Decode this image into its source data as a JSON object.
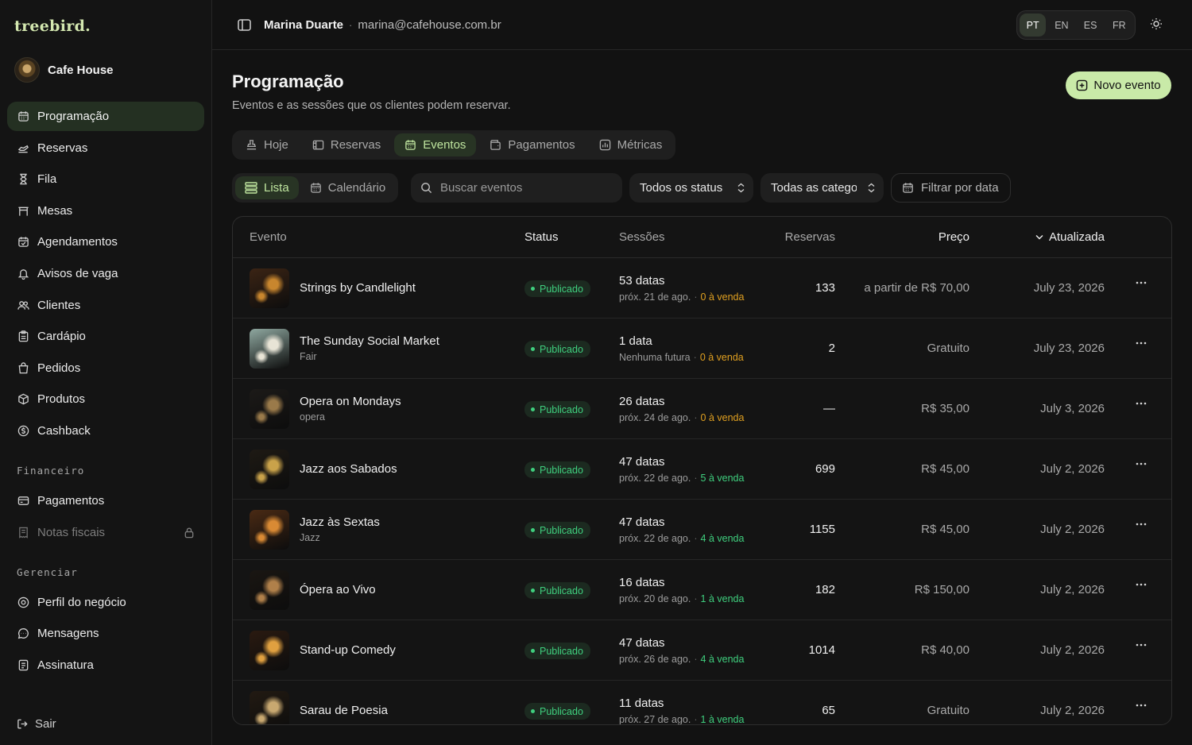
{
  "brand": {
    "logo": "treebird.",
    "business_name": "Cafe House"
  },
  "sidebar": {
    "items": [
      {
        "label": "Programação",
        "icon": "calendar-icon",
        "active": true
      },
      {
        "label": "Reservas",
        "icon": "hand-icon"
      },
      {
        "label": "Fila",
        "icon": "hourglass-icon"
      },
      {
        "label": "Mesas",
        "icon": "table-icon"
      },
      {
        "label": "Agendamentos",
        "icon": "calendar-check-icon"
      },
      {
        "label": "Avisos de vaga",
        "icon": "bell-icon"
      },
      {
        "label": "Clientes",
        "icon": "users-icon"
      },
      {
        "label": "Cardápio",
        "icon": "clipboard-icon"
      },
      {
        "label": "Pedidos",
        "icon": "shopping-bag-icon"
      },
      {
        "label": "Produtos",
        "icon": "package-icon"
      },
      {
        "label": "Cashback",
        "icon": "cashback-icon"
      }
    ],
    "financeiro_title": "Financeiro",
    "financeiro_items": [
      {
        "label": "Pagamentos",
        "icon": "credit-card-icon"
      },
      {
        "label": "Notas fiscais",
        "icon": "receipt-icon",
        "locked": true
      }
    ],
    "gerenciar_title": "Gerenciar",
    "gerenciar_items": [
      {
        "label": "Perfil do negócio",
        "icon": "location-icon"
      },
      {
        "label": "Mensagens",
        "icon": "message-icon"
      },
      {
        "label": "Assinatura",
        "icon": "document-icon"
      }
    ],
    "logout": "Sair"
  },
  "topbar": {
    "user_name": "Marina Duarte",
    "separator": "·",
    "user_email": "marina@cafehouse.com.br",
    "languages": [
      "PT",
      "EN",
      "ES",
      "FR"
    ],
    "active_language": "PT"
  },
  "page": {
    "title": "Programação",
    "subtitle": "Eventos e as sessões que os clientes podem reservar.",
    "new_button": "Novo evento"
  },
  "tabs": [
    {
      "label": "Hoje",
      "icon": "stamp-icon"
    },
    {
      "label": "Reservas",
      "icon": "book-icon"
    },
    {
      "label": "Eventos",
      "icon": "calendar-icon",
      "active": true
    },
    {
      "label": "Pagamentos",
      "icon": "wallet-icon"
    },
    {
      "label": "Métricas",
      "icon": "chart-icon"
    }
  ],
  "views": [
    {
      "label": "Lista",
      "icon": "list-icon",
      "active": true
    },
    {
      "label": "Calendário",
      "icon": "calendar-icon"
    }
  ],
  "search": {
    "placeholder": "Buscar eventos"
  },
  "filters": {
    "status": "Todos os status",
    "category": "Todas as categorias",
    "date": "Filtrar por data"
  },
  "table": {
    "headers": {
      "event": "Evento",
      "status": "Status",
      "sessions": "Sessões",
      "bookings": "Reservas",
      "price": "Preço",
      "updated": "Atualizada"
    },
    "rows": [
      {
        "title": "Strings by Candlelight",
        "category": "",
        "status": "Publicado",
        "sessions": "53 datas",
        "next": "próx. 21 de ago.",
        "sale": "0 à venda",
        "sale_zero": true,
        "bookings": "133",
        "price": "a partir de R$ 70,00",
        "updated": "July 23, 2026",
        "thumb_a": "#3b2414",
        "thumb_b": "#c8862e"
      },
      {
        "title": "The Sunday Social Market",
        "category": "Fair",
        "status": "Publicado",
        "sessions": "1 data",
        "next": "Nenhuma futura",
        "sale": "0 à venda",
        "sale_zero": true,
        "bookings": "2",
        "price": "Gratuito",
        "updated": "July 23, 2026",
        "thumb_a": "#8fa8a0",
        "thumb_b": "#e8e4d6"
      },
      {
        "title": "Opera on Mondays",
        "category": "opera",
        "status": "Publicado",
        "sessions": "26 datas",
        "next": "próx. 24 de ago.",
        "sale": "0 à venda",
        "sale_zero": true,
        "bookings": "—",
        "price": "R$ 35,00",
        "updated": "July 3, 2026",
        "thumb_a": "#1c1a18",
        "thumb_b": "#9a7a4a"
      },
      {
        "title": "Jazz aos Sabados",
        "category": "",
        "status": "Publicado",
        "sessions": "47 datas",
        "next": "próx. 22 de ago.",
        "sale": "5 à venda",
        "sale_zero": false,
        "bookings": "699",
        "price": "R$ 45,00",
        "updated": "July 2, 2026",
        "thumb_a": "#1e1a14",
        "thumb_b": "#c9a24a"
      },
      {
        "title": "Jazz às Sextas",
        "category": "Jazz",
        "status": "Publicado",
        "sessions": "47 datas",
        "next": "próx. 22 de ago.",
        "sale": "4 à venda",
        "sale_zero": false,
        "bookings": "1155",
        "price": "R$ 45,00",
        "updated": "July 2, 2026",
        "thumb_a": "#4a2a14",
        "thumb_b": "#d98a34"
      },
      {
        "title": "Ópera ao Vivo",
        "category": "",
        "status": "Publicado",
        "sessions": "16 datas",
        "next": "próx. 20 de ago.",
        "sale": "1 à venda",
        "sale_zero": false,
        "bookings": "182",
        "price": "R$ 150,00",
        "updated": "July 2, 2026",
        "thumb_a": "#1a1612",
        "thumb_b": "#b0804a"
      },
      {
        "title": "Stand-up Comedy",
        "category": "",
        "status": "Publicado",
        "sessions": "47 datas",
        "next": "próx. 26 de ago.",
        "sale": "4 à venda",
        "sale_zero": false,
        "bookings": "1014",
        "price": "R$ 40,00",
        "updated": "July 2, 2026",
        "thumb_a": "#2a1a10",
        "thumb_b": "#e0a040"
      },
      {
        "title": "Sarau de Poesia",
        "category": "",
        "status": "Publicado",
        "sessions": "11 datas",
        "next": "próx. 27 de ago.",
        "sale": "1 à venda",
        "sale_zero": false,
        "bookings": "65",
        "price": "Gratuito",
        "updated": "July 2, 2026",
        "thumb_a": "#221a12",
        "thumb_b": "#c8a870"
      }
    ]
  },
  "colors": {
    "accent": "#c9eaa8",
    "accent_text": "#bfe59f",
    "success": "#3fcf7e",
    "warning": "#e0a020",
    "background": "#121212"
  }
}
